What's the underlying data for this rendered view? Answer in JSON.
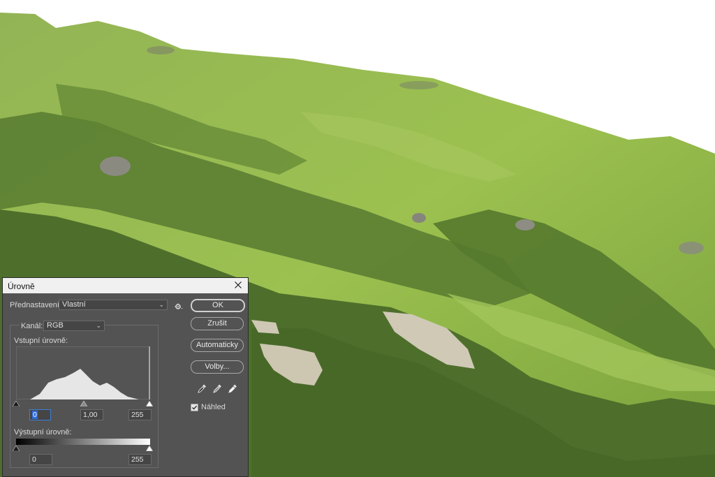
{
  "window": {
    "title": "Úrovně"
  },
  "preset": {
    "label": "Přednastavení:",
    "value": "Vlastní"
  },
  "buttons": {
    "ok": "OK",
    "cancel": "Zrušit",
    "auto": "Automaticky",
    "options": "Volby..."
  },
  "channel": {
    "label": "Kanál:",
    "value": "RGB"
  },
  "input_levels": {
    "label": "Vstupní úrovně:",
    "black": "0",
    "gamma": "1,00",
    "white": "255"
  },
  "output_levels": {
    "label": "Výstupní úrovně:",
    "black": "0",
    "white": "255"
  },
  "preview": {
    "label": "Náhled",
    "checked": true
  },
  "icons": [
    "close-icon",
    "gear-icon",
    "black-point-eyedropper-icon",
    "gray-point-eyedropper-icon",
    "white-point-eyedropper-icon",
    "checkmark-icon"
  ],
  "colors": {
    "dialog_bg": "#535353",
    "focus_blue": "#2e6bd8",
    "grass": "#8fb34a",
    "shrub": "#4b6a2a"
  }
}
